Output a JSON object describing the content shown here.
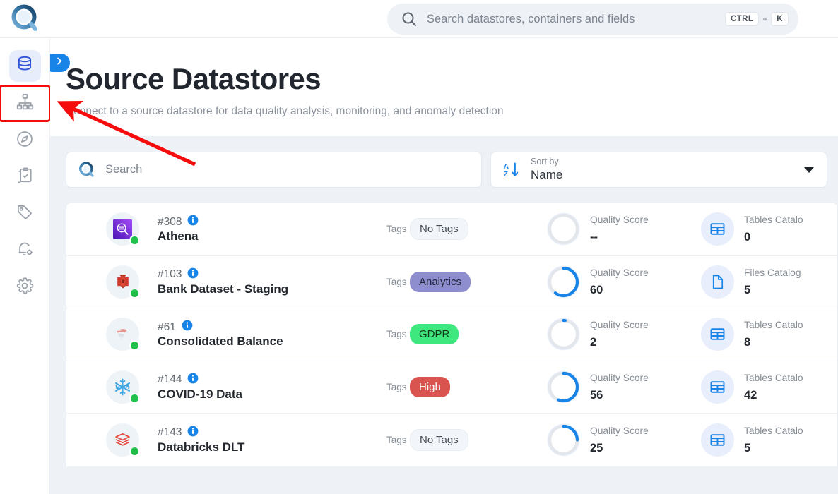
{
  "brand": {
    "logo_name": "quality-lens-logo"
  },
  "global_search": {
    "placeholder": "Search datastores, containers and fields",
    "shortcut_key1": "CTRL",
    "shortcut_plus": "+",
    "shortcut_key2": "K"
  },
  "sidebar": {
    "items": [
      {
        "name": "datastores",
        "icon": "database-icon",
        "active": true,
        "highlighted": false
      },
      {
        "name": "hierarchy",
        "icon": "sitemap-icon",
        "active": false,
        "highlighted": true
      },
      {
        "name": "explore",
        "icon": "compass-icon",
        "active": false,
        "highlighted": false
      },
      {
        "name": "tasks",
        "icon": "clipboard-check-icon",
        "active": false,
        "highlighted": false
      },
      {
        "name": "tags",
        "icon": "tag-icon",
        "active": false,
        "highlighted": false
      },
      {
        "name": "notifications",
        "icon": "bell-settings-icon",
        "active": false,
        "highlighted": false
      },
      {
        "name": "settings",
        "icon": "gear-icon",
        "active": false,
        "highlighted": false
      }
    ]
  },
  "header": {
    "title": "Source Datastores",
    "subtitle": "Connect to a source datastore for data quality analysis, monitoring, and anomaly detection",
    "expander_icon": "chevron-right-icon"
  },
  "filters": {
    "search_placeholder": "Search",
    "sort_label": "Sort by",
    "sort_value": "Name",
    "sort_icon": "sort-alpha-down-icon",
    "caret_icon": "chevron-down-icon"
  },
  "labels": {
    "tags": "Tags",
    "quality_score": "Quality Score",
    "tables_catalog": "Tables Catalo",
    "files_catalog": "Files Catalog",
    "info_icon": "info-icon",
    "no_tags": "No Tags"
  },
  "colors": {
    "accent": "#1884e8",
    "status_online": "#21bf4b",
    "tag_analytics": "#8e8ece",
    "tag_gdpr": "#3ee87e",
    "tag_high": "#d9534f",
    "annotation": "#f50d0d",
    "page_bg": "#eef2f7"
  },
  "datastores": [
    {
      "id": "#308",
      "name": "Athena",
      "icon": "athena-icon",
      "status": "online",
      "tags_label": "Tags",
      "tag": "No Tags",
      "tag_style": "none",
      "quality_label": "Quality Score",
      "quality_value": "--",
      "quality_pct": 0,
      "catalog_label": "Tables Catalo",
      "catalog_value": "0",
      "catalog_icon": "table-icon"
    },
    {
      "id": "#103",
      "name": "Bank Dataset - Staging",
      "icon": "sqlserver-icon",
      "status": "online",
      "tags_label": "Tags",
      "tag": "Analytics",
      "tag_style": "analytics",
      "quality_label": "Quality Score",
      "quality_value": "60",
      "quality_pct": 60,
      "catalog_label": "Files Catalog",
      "catalog_value": "5",
      "catalog_icon": "file-icon"
    },
    {
      "id": "#61",
      "name": "Consolidated Balance",
      "icon": "sqlserver-faded-icon",
      "status": "online",
      "tags_label": "Tags",
      "tag": "GDPR",
      "tag_style": "gdpr",
      "quality_label": "Quality Score",
      "quality_value": "2",
      "quality_pct": 2,
      "catalog_label": "Tables Catalo",
      "catalog_value": "8",
      "catalog_icon": "table-icon"
    },
    {
      "id": "#144",
      "name": "COVID-19 Data",
      "icon": "snowflake-icon",
      "status": "online",
      "tags_label": "Tags",
      "tag": "High",
      "tag_style": "high",
      "quality_label": "Quality Score",
      "quality_value": "56",
      "quality_pct": 56,
      "catalog_label": "Tables Catalo",
      "catalog_value": "42",
      "catalog_icon": "table-icon"
    },
    {
      "id": "#143",
      "name": "Databricks DLT",
      "icon": "databricks-icon",
      "status": "online",
      "tags_label": "Tags",
      "tag": "No Tags",
      "tag_style": "none",
      "quality_label": "Quality Score",
      "quality_value": "25",
      "quality_pct": 25,
      "catalog_label": "Tables Catalo",
      "catalog_value": "5",
      "catalog_icon": "table-icon"
    }
  ]
}
